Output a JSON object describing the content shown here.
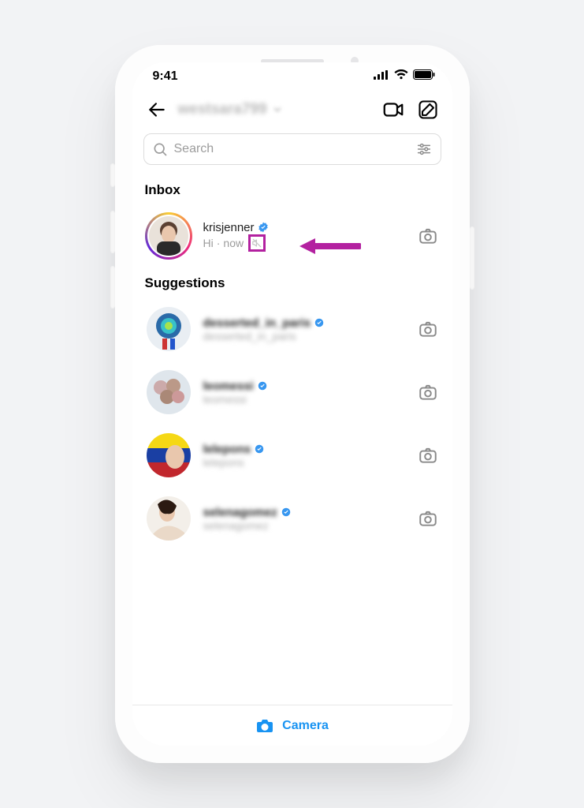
{
  "status": {
    "time": "9:41"
  },
  "nav": {
    "username": "westsara799"
  },
  "search": {
    "placeholder": "Search"
  },
  "sections": {
    "inbox_title": "Inbox",
    "suggestions_title": "Suggestions"
  },
  "inbox": [
    {
      "username": "krisjenner",
      "verified": true,
      "preview": "Hi",
      "time": "now",
      "muted": true,
      "has_story": true
    }
  ],
  "suggestions": [
    {
      "username": "desserted_in_paris",
      "subtitle": "desserted_in_paris",
      "verified": true
    },
    {
      "username": "leomessi",
      "subtitle": "leomessi",
      "verified": true
    },
    {
      "username": "lelepons",
      "subtitle": "lelepons",
      "verified": true
    },
    {
      "username": "selenagomez",
      "subtitle": "selenagomez",
      "verified": true
    }
  ],
  "bottom": {
    "camera_label": "Camera"
  },
  "annotation": {
    "arrow_color": "#b321a0"
  }
}
